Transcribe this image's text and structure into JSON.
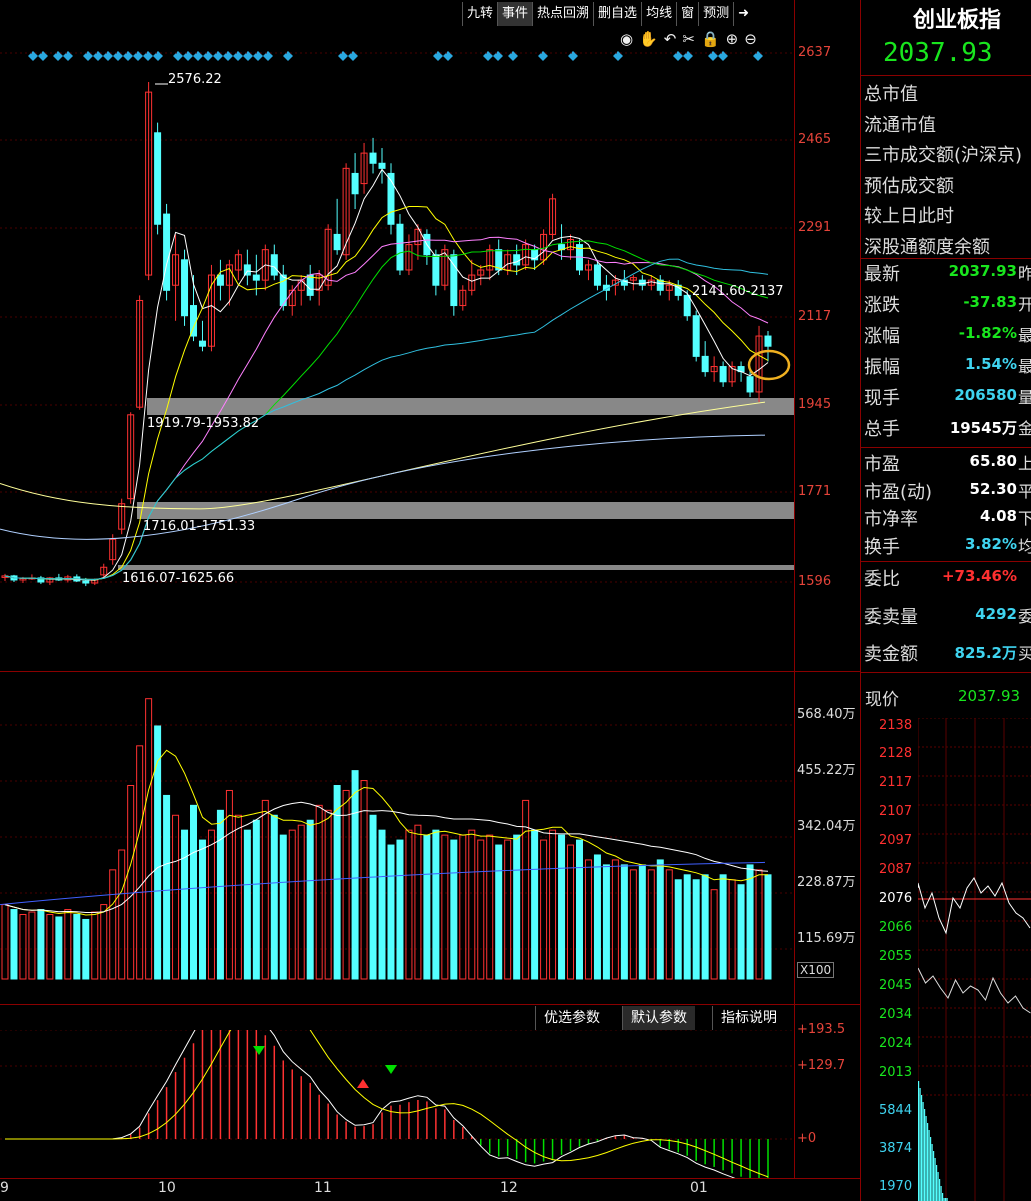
{
  "toolbar": {
    "items": [
      "九转",
      "事件",
      "热点回溯",
      "删自选",
      "均线",
      "窗",
      "预测"
    ],
    "active_index": 1,
    "arrow": "➜"
  },
  "icons": [
    "eye-icon",
    "hand-icon",
    "undo-icon",
    "scissors-icon",
    "lock-icon",
    "zoom-in-icon",
    "zoom-out-icon"
  ],
  "main_axis": {
    "labels": [
      "2637",
      "2465",
      "2291",
      "2117",
      "1945",
      "1771",
      "1596"
    ]
  },
  "annotations": {
    "high": "2576.22",
    "band1": "1919.79-1953.82",
    "band2": "1716.01-1751.33",
    "band3": "1616.07-1625.66",
    "ma_label": "2141.60-2137"
  },
  "volume_axis": {
    "labels": [
      "568.40万",
      "455.22万",
      "342.04万",
      "228.87万",
      "115.69万"
    ],
    "unit": "X100"
  },
  "macd": {
    "buttons": [
      "优选参数",
      "默认参数",
      "指标说明"
    ],
    "active_index": 1,
    "labels": [
      "+193.5",
      "+129.7",
      "+0"
    ]
  },
  "x_axis": {
    "labels": [
      "9",
      "10",
      "11",
      "12",
      "01"
    ]
  },
  "panel": {
    "title": "创业板指",
    "price": "2037.93",
    "info": [
      "总市值",
      "流通市值",
      "三市成交额(沪深京)",
      "预估成交额",
      "较上日此时",
      "深股通额度余额"
    ],
    "quote": [
      {
        "label": "最新",
        "value": "2037.93",
        "suffix": "昨",
        "color": "#19e61e"
      },
      {
        "label": "涨跌",
        "value": "-37.83",
        "suffix": "开",
        "color": "#19e61e"
      },
      {
        "label": "涨幅",
        "value": "-1.82%",
        "suffix": "最",
        "color": "#19e61e"
      },
      {
        "label": "振幅",
        "value": "1.54%",
        "suffix": "最",
        "color": "#3fd4f0"
      },
      {
        "label": "现手",
        "value": "206580",
        "suffix": "量",
        "color": "#3fd4f0"
      },
      {
        "label": "总手",
        "value": "19545万",
        "suffix": "金",
        "color": "#ffffff"
      }
    ],
    "valuation": [
      {
        "label": "市盈",
        "value": "65.80",
        "suffix": "上",
        "color": "#ffffff"
      },
      {
        "label": "市盈(动)",
        "value": "52.30",
        "suffix": "平",
        "color": "#ffffff"
      },
      {
        "label": "市净率",
        "value": "4.08",
        "suffix": "下",
        "color": "#ffffff"
      },
      {
        "label": "换手",
        "value": "3.82%",
        "suffix": "均",
        "color": "#3fd4f0"
      }
    ],
    "order": [
      {
        "label": "委比",
        "value": "+73.46%",
        "suffix": "",
        "color": "#ff3030"
      },
      {
        "label": "委卖量",
        "value": "4292",
        "suffix": "委",
        "color": "#3fd4f0"
      },
      {
        "label": "卖金额",
        "value": "825.2万",
        "suffix": "买",
        "color": "#3fd4f0"
      }
    ],
    "current": {
      "label": "现价",
      "value": "2037.93"
    },
    "mini_axis": [
      "2138",
      "2128",
      "2117",
      "2107",
      "2097",
      "2087",
      "2076",
      "2066",
      "2055",
      "2045",
      "2034",
      "2024",
      "2013",
      "5844",
      "3874",
      "1970"
    ]
  },
  "colors": {
    "up": "#ff3232",
    "down": "#54ffff",
    "ma5": "#ffffff",
    "ma10": "#ffff00",
    "ma20": "#ff80ff",
    "ma30": "#00e000",
    "ma60": "#30c0e0",
    "ma120": "#ffff99",
    "ma250": "#b0d0ff",
    "grid": "#5a0000",
    "axis": "#e5443a"
  }
}
